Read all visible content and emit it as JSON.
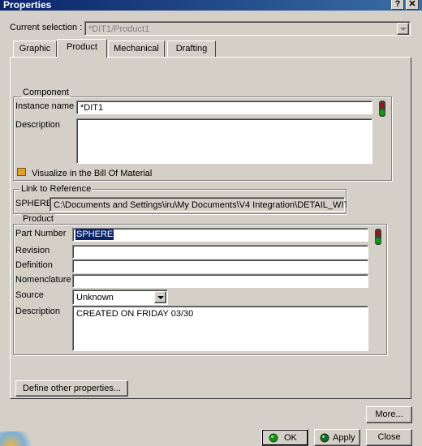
{
  "window": {
    "title": "Properties",
    "help": "?",
    "close": "✕"
  },
  "current_selection": {
    "label": "Current selection :",
    "value": "*DIT1/Product1"
  },
  "tabs": [
    {
      "label": "Graphic"
    },
    {
      "label": "Product"
    },
    {
      "label": "Mechanical"
    },
    {
      "label": "Drafting"
    }
  ],
  "component": {
    "title": "Component",
    "instance_label": "Instance name",
    "instance_value": "*DIT1",
    "description_label": "Description",
    "description_value": "",
    "bom_label": "Visualize in the Bill Of Material"
  },
  "link": {
    "title": "Link to Reference",
    "name": "SPHERE",
    "path": "C:\\Documents and Settings\\iru\\My Documents\\V4 Integration\\DETAIL_WIT"
  },
  "product": {
    "title": "Product",
    "part_number_label": "Part Number",
    "part_number_value": "SPHERE",
    "revision_label": "Revision",
    "revision_value": "",
    "definition_label": "Definition",
    "definition_value": "",
    "nomenclature_label": "Nomenclature",
    "nomenclature_value": "",
    "source_label": "Source",
    "source_value": "Unknown",
    "description_label": "Description",
    "description_value": "CREATED ON FRIDAY 03/30"
  },
  "buttons": {
    "define_other": "Define other properties...",
    "more": "More...",
    "ok": "OK",
    "apply": "Apply",
    "close": "Close"
  },
  "colors": {
    "title_bar": "#0a246a",
    "ok_icon": "#1a8f1a",
    "selection": "#0a246a"
  },
  "icons": {
    "status_light": "traffic-light-icon"
  }
}
